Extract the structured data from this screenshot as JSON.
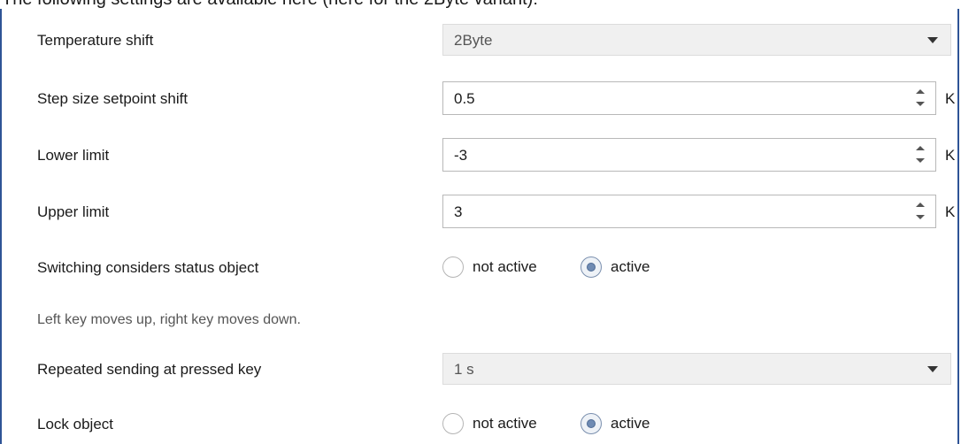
{
  "caption": "The following settings are available here (here for the 2Byte variant):",
  "settings": {
    "temperature_shift": {
      "label": "Temperature shift",
      "value": "2Byte"
    },
    "step_size": {
      "label": "Step size setpoint shift",
      "value": "0.5",
      "unit": "K"
    },
    "lower_limit": {
      "label": "Lower limit",
      "value": "-3",
      "unit": "K"
    },
    "upper_limit": {
      "label": "Upper limit",
      "value": "3",
      "unit": "K"
    },
    "switching_status": {
      "label": "Switching considers status object",
      "options": [
        "not active",
        "active"
      ],
      "selected": "active"
    },
    "hint": "Left key moves up, right key moves down.",
    "repeated_sending": {
      "label": "Repeated sending at pressed key",
      "value": "1 s"
    },
    "lock_object": {
      "label": "Lock object",
      "options": [
        "not active",
        "active"
      ],
      "selected": "active"
    }
  },
  "colors": {
    "frame": "#2f5496",
    "disabled_bg": "#f0f0f0",
    "radio_selected": "#6f8bb3"
  },
  "icons": {
    "dropdown": "chevron-down-icon",
    "spin_up": "spin-up-icon",
    "spin_down": "spin-down-icon"
  }
}
